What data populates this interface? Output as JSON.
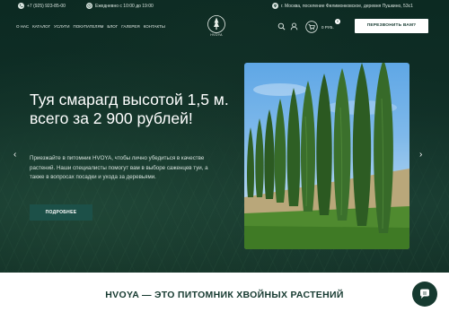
{
  "topbar": {
    "phone": "+7 (925) 923-85-00",
    "hours": "Ежедневно  с 10:00 до 19:00",
    "address": "г. Москва, поселение Филимонковское, деревня Пушкино, 53с1"
  },
  "nav": {
    "items": [
      "О НАС",
      "КАТАЛОГ",
      "УСЛУГИ",
      "ПОКУПАТЕЛЯМ",
      "БЛОГ",
      "ГАЛЕРЕЯ",
      "КОНТАКТЫ"
    ]
  },
  "logo": {
    "text": "HVOYA"
  },
  "header": {
    "cart_count": "0",
    "cart_sum": "0 РУБ.",
    "call_button": "ПЕРЕЗВОНИТЬ ВАМ?"
  },
  "hero": {
    "headline": "Туя смарагд высотой 1,5 м. всего за 2 900 рублей!",
    "description": "Приезжайте в питомник HVOYA, чтобы лично убедиться в качестве растений. Наши специалисты помогут вам в выборе саженцев туи, а также в вопросах посадки и ухода за деревьями.",
    "button": "ПОДРОБНЕЕ",
    "arrow_left": "‹",
    "arrow_right": "›"
  },
  "section": {
    "title": "HVOYA — ЭТО ПИТОМНИК ХВОЙНЫХ РАСТЕНИЙ"
  },
  "colors": {
    "brand_dark": "#163a30",
    "button_teal": "#1c5048"
  }
}
